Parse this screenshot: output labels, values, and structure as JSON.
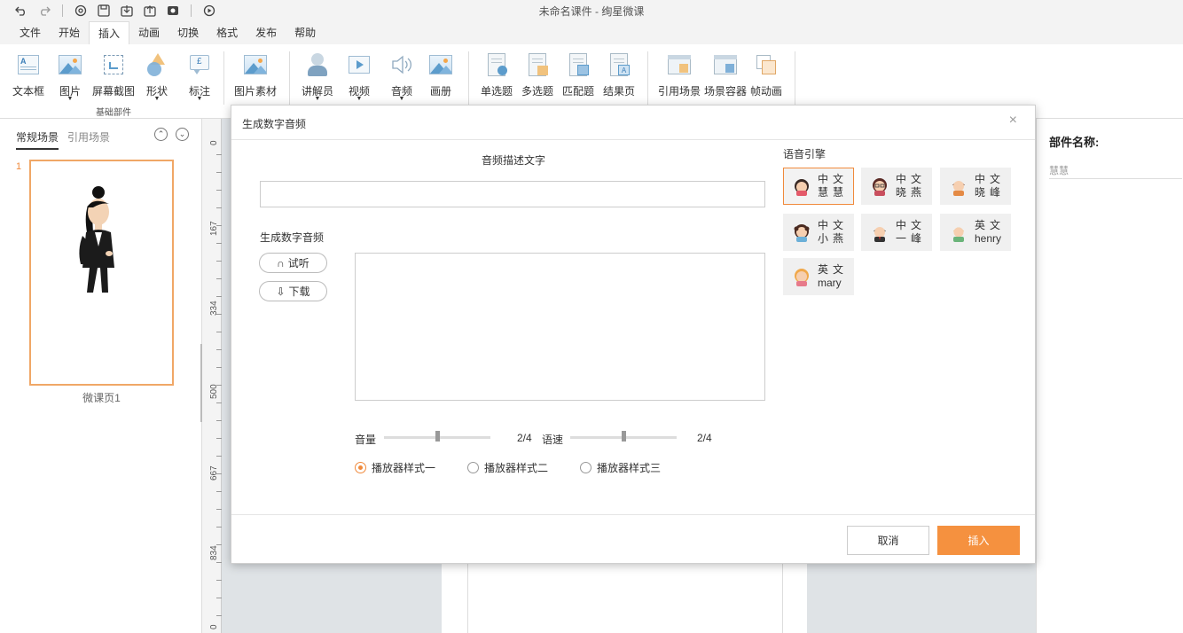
{
  "app": {
    "title": "未命名课件 - 绚星微课"
  },
  "quick_access": [
    "undo-icon",
    "redo-icon",
    "settings-icon",
    "save-icon",
    "import-icon",
    "export-icon",
    "publish-icon",
    "preview-icon"
  ],
  "menu": {
    "items": [
      "文件",
      "开始",
      "插入",
      "动画",
      "切换",
      "格式",
      "发布",
      "帮助"
    ],
    "active": "插入"
  },
  "ribbon": {
    "group_basic": "基础部件",
    "buttons": {
      "textbox": "文本框",
      "image": "图片",
      "screenshot": "屏幕截图",
      "shape": "形状",
      "callout": "标注",
      "image_material": "图片素材",
      "presenter": "讲解员",
      "video": "视频",
      "audio": "音频",
      "album": "画册",
      "single_choice": "单选题",
      "multi_choice": "多选题",
      "matching": "匹配题",
      "result_page": "结果页",
      "reference_scene": "引用场景",
      "scene_container": "场景容器",
      "frame_anim": "帧动画"
    }
  },
  "left_panel": {
    "tabs": [
      "常规场景",
      "引用场景"
    ],
    "active_tab": "常规场景",
    "slides": [
      {
        "number": "1",
        "name": "微课页1"
      }
    ]
  },
  "ruler": {
    "labels": [
      "0",
      "167",
      "334",
      "500",
      "667",
      "834",
      "0"
    ]
  },
  "right_panel": {
    "label": "部件名称:",
    "value": "慧慧"
  },
  "dialog": {
    "title": "生成数字音频",
    "close": "×",
    "description_label": "音频描述文字",
    "description_value": "",
    "generate_label": "生成数字音频",
    "listen_button": "试听",
    "download_button": "下载",
    "volume_label": "音量",
    "volume_value": "2/4",
    "volume_level": 0.5,
    "speed_label": "语速",
    "speed_value": "2/4",
    "speed_level": 0.5,
    "player_styles": [
      "播放器样式一",
      "播放器样式二",
      "播放器样式三"
    ],
    "player_style_selected": 0,
    "engine_label": "语音引擎",
    "voices": [
      {
        "lang": "中文",
        "name": "慧慧",
        "selected": true
      },
      {
        "lang": "中文",
        "name": "晓燕",
        "selected": false
      },
      {
        "lang": "中文",
        "name": "晓峰",
        "selected": false
      },
      {
        "lang": "中文",
        "name": "小燕",
        "selected": false
      },
      {
        "lang": "中文",
        "name": "一峰",
        "selected": false
      },
      {
        "lang": "英文",
        "name": "henry",
        "selected": false
      },
      {
        "lang": "英文",
        "name": "mary",
        "selected": false
      }
    ],
    "cancel_button": "取消",
    "insert_button": "插入"
  },
  "colors": {
    "accent": "#f5913f",
    "selected_border": "#f08a3c"
  }
}
